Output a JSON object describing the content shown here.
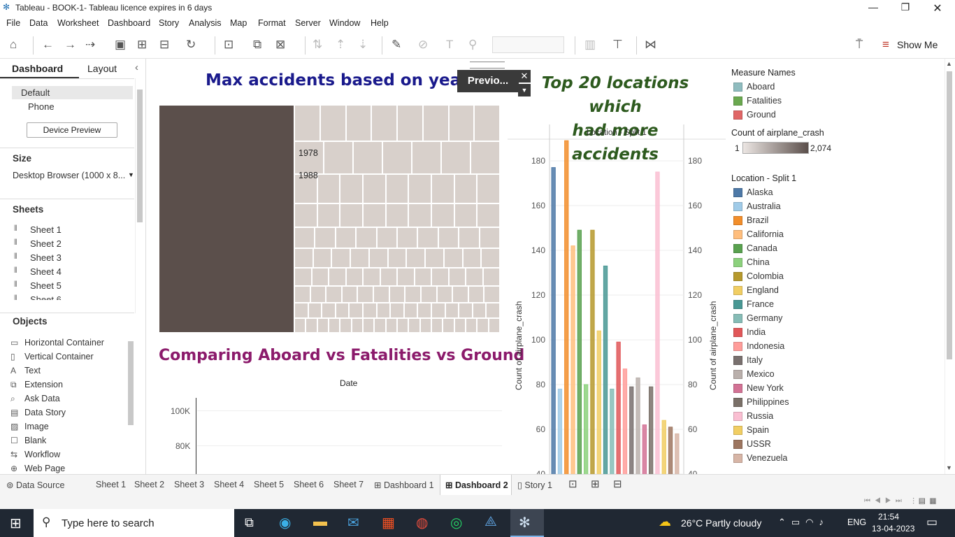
{
  "window": {
    "title": "Tableau - BOOK-1- Tableau licence expires in 6 days"
  },
  "menu": [
    "File",
    "Data",
    "Worksheet",
    "Dashboard",
    "Story",
    "Analysis",
    "Map",
    "Format",
    "Server",
    "Window",
    "Help"
  ],
  "toolbar": {
    "show_me": "Show Me"
  },
  "leftpanel": {
    "tabs": {
      "dashboard": "Dashboard",
      "layout": "Layout"
    },
    "devices": [
      "Default",
      "Phone"
    ],
    "device_preview": "Device Preview",
    "size_header": "Size",
    "size_value": "Desktop Browser (1000 x 8...",
    "sheets_header": "Sheets",
    "sheets": [
      "Sheet 1",
      "Sheet 2",
      "Sheet 3",
      "Sheet 4",
      "Sheet 5",
      "Sheet 6"
    ],
    "objects_header": "Objects",
    "objects": [
      {
        "label": "Horizontal Container",
        "icon": "horizontal-container-icon",
        "glyph": "▭"
      },
      {
        "label": "Vertical Container",
        "icon": "vertical-container-icon",
        "glyph": "▯"
      },
      {
        "label": "Text",
        "icon": "text-icon",
        "glyph": "A"
      },
      {
        "label": "Extension",
        "icon": "extension-icon",
        "glyph": "⧉"
      },
      {
        "label": "Ask Data",
        "icon": "ask-data-icon",
        "glyph": "⌕"
      },
      {
        "label": "Data Story",
        "icon": "data-story-icon",
        "glyph": "▤"
      },
      {
        "label": "Image",
        "icon": "image-icon",
        "glyph": "▨"
      },
      {
        "label": "Blank",
        "icon": "blank-icon",
        "glyph": "☐"
      },
      {
        "label": "Workflow",
        "icon": "workflow-icon",
        "glyph": "⇆"
      },
      {
        "label": "Web Page",
        "icon": "web-page-icon",
        "glyph": "⊕"
      }
    ]
  },
  "dashboard": {
    "treemap_title": "Max accidents based on years",
    "treemap_labels": [
      "1978",
      "1988"
    ],
    "prev_button": "Previo...",
    "compare_title": "Comparing Aboard vs Fatalities vs Ground",
    "compare_header": "Date",
    "compare_ticks": [
      "100K",
      "80K"
    ],
    "bar_title_line1": "Top 20 locations which",
    "bar_title_line2": "had more accidents",
    "bar_header": "Location - Split 1",
    "y_axis_label": "Count of airplane_crash",
    "colors": {
      "treemap_dark": "#5b4f4b",
      "treemap_light": "#d8d0cb",
      "title_blue": "#1a1a8c",
      "title_purple": "#8b1a6b",
      "title_green": "#2d5a1e"
    }
  },
  "legends": {
    "measure_header": "Measure Names",
    "measures": [
      {
        "name": "Aboard",
        "color": "#8fbcbf"
      },
      {
        "name": "Fatalities",
        "color": "#6aa84f"
      },
      {
        "name": "Ground",
        "color": "#e06666"
      }
    ],
    "count_header": "Count of airplane_crash",
    "count_min": "1",
    "count_max": "2,074",
    "location_header": "Location - Split 1"
  },
  "chart_data": {
    "type": "bar",
    "title": "Top 20 locations which had more accidents",
    "xlabel": "Location - Split 1",
    "ylabel": "Count of airplane_crash",
    "ylim": [
      40,
      190
    ],
    "yticks": [
      180,
      160,
      140,
      120,
      100,
      80,
      60,
      40
    ],
    "categories": [
      "Alaska",
      "Australia",
      "Brazil",
      "California",
      "Canada",
      "China",
      "Colombia",
      "England",
      "France",
      "Germany",
      "India",
      "Indonesia",
      "Italy",
      "Mexico",
      "New York",
      "Philippines",
      "Russia",
      "Spain",
      "USSR",
      "Venezuela"
    ],
    "values": [
      177,
      78,
      189,
      142,
      149,
      80,
      149,
      104,
      133,
      78,
      99,
      87,
      79,
      83,
      62,
      79,
      175,
      64,
      61,
      58
    ],
    "colors": [
      "#4e79a7",
      "#a0cbe8",
      "#f28e2b",
      "#ffbe7d",
      "#59a14f",
      "#8cd17d",
      "#b6992d",
      "#f1ce63",
      "#499894",
      "#86bcb6",
      "#e15759",
      "#ff9d9a",
      "#79706e",
      "#bab0ac",
      "#d37295",
      "#7a7068",
      "#fabfd2",
      "#f1ce63",
      "#9d7660",
      "#d7b5a6"
    ]
  },
  "tabs": [
    "Data Source",
    "Sheet 1",
    "Sheet 2",
    "Sheet 3",
    "Sheet 4",
    "Sheet 5",
    "Sheet 6",
    "Sheet 7",
    "Dashboard 1",
    "Dashboard 2",
    "Story 1"
  ],
  "taskbar": {
    "search_placeholder": "Type here to search",
    "weather": "26°C  Partly cloudy",
    "lang": "ENG",
    "time": "21:54",
    "date": "13-04-2023"
  }
}
